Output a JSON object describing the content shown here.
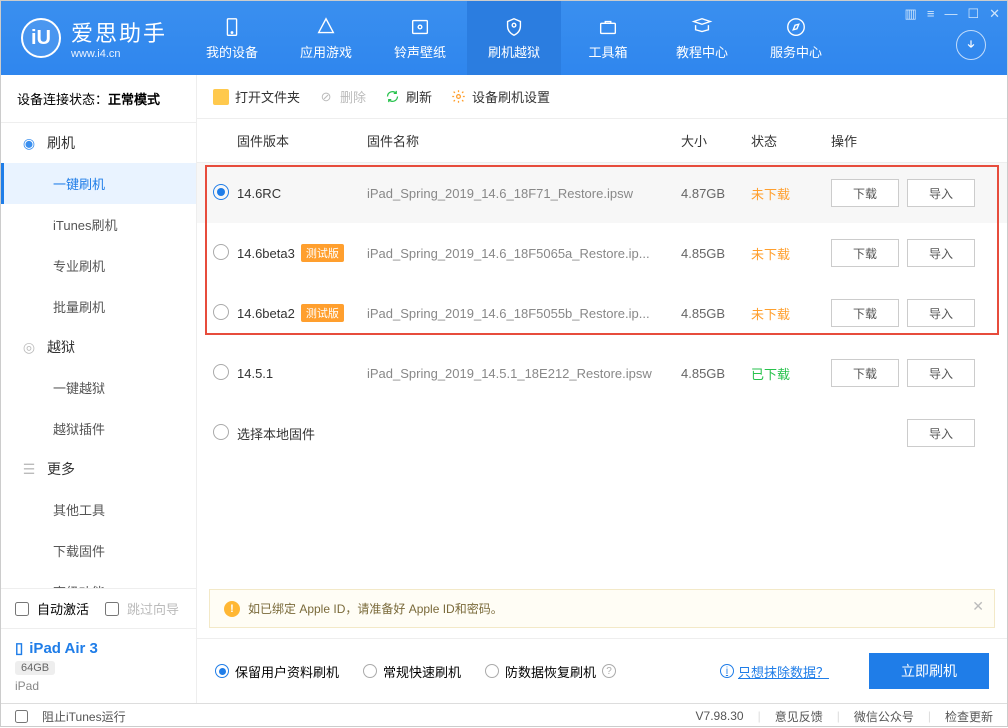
{
  "app": {
    "name": "爱思助手",
    "site": "www.i4.cn"
  },
  "nav": [
    {
      "label": "我的设备"
    },
    {
      "label": "应用游戏"
    },
    {
      "label": "铃声壁纸"
    },
    {
      "label": "刷机越狱"
    },
    {
      "label": "工具箱"
    },
    {
      "label": "教程中心"
    },
    {
      "label": "服务中心"
    }
  ],
  "conn": {
    "label": "设备连接状态：",
    "value": "正常模式"
  },
  "sidebar": {
    "flash": {
      "title": "刷机",
      "items": [
        "一键刷机",
        "iTunes刷机",
        "专业刷机",
        "批量刷机"
      ]
    },
    "jb": {
      "title": "越狱",
      "items": [
        "一键越狱",
        "越狱插件"
      ]
    },
    "more": {
      "title": "更多",
      "items": [
        "其他工具",
        "下载固件",
        "高级功能"
      ]
    }
  },
  "checks": {
    "auto": "自动激活",
    "skip": "跳过向导"
  },
  "device": {
    "name": "iPad Air 3",
    "storage": "64GB",
    "type": "iPad"
  },
  "toolbar": {
    "open": "打开文件夹",
    "del": "删除",
    "refresh": "刷新",
    "settings": "设备刷机设置"
  },
  "columns": {
    "ver": "固件版本",
    "name": "固件名称",
    "size": "大小",
    "status": "状态",
    "op": "操作"
  },
  "beta_tag": "测试版",
  "rows": [
    {
      "ver": "14.6RC",
      "beta": false,
      "name": "iPad_Spring_2019_14.6_18F71_Restore.ipsw",
      "size": "4.87GB",
      "status": "未下载",
      "dl": false,
      "sel": true
    },
    {
      "ver": "14.6beta3",
      "beta": true,
      "name": "iPad_Spring_2019_14.6_18F5065a_Restore.ip...",
      "size": "4.85GB",
      "status": "未下载",
      "dl": false,
      "sel": false
    },
    {
      "ver": "14.6beta2",
      "beta": true,
      "name": "iPad_Spring_2019_14.6_18F5055b_Restore.ip...",
      "size": "4.85GB",
      "status": "未下载",
      "dl": false,
      "sel": false
    },
    {
      "ver": "14.5.1",
      "beta": false,
      "name": "iPad_Spring_2019_14.5.1_18E212_Restore.ipsw",
      "size": "4.85GB",
      "status": "已下载",
      "dl": true,
      "sel": false
    }
  ],
  "local_fw": "选择本地固件",
  "ops": {
    "download": "下载",
    "import": "导入"
  },
  "notice": "如已绑定 Apple ID，请准备好 Apple ID和密码。",
  "modes": {
    "keep": "保留用户资料刷机",
    "fast": "常规快速刷机",
    "recover": "防数据恢复刷机",
    "erase": "只想抹除数据？"
  },
  "flash_btn": "立即刷机",
  "footer": {
    "block": "阻止iTunes运行",
    "ver": "V7.98.30",
    "feedback": "意见反馈",
    "wechat": "微信公众号",
    "update": "检查更新"
  }
}
